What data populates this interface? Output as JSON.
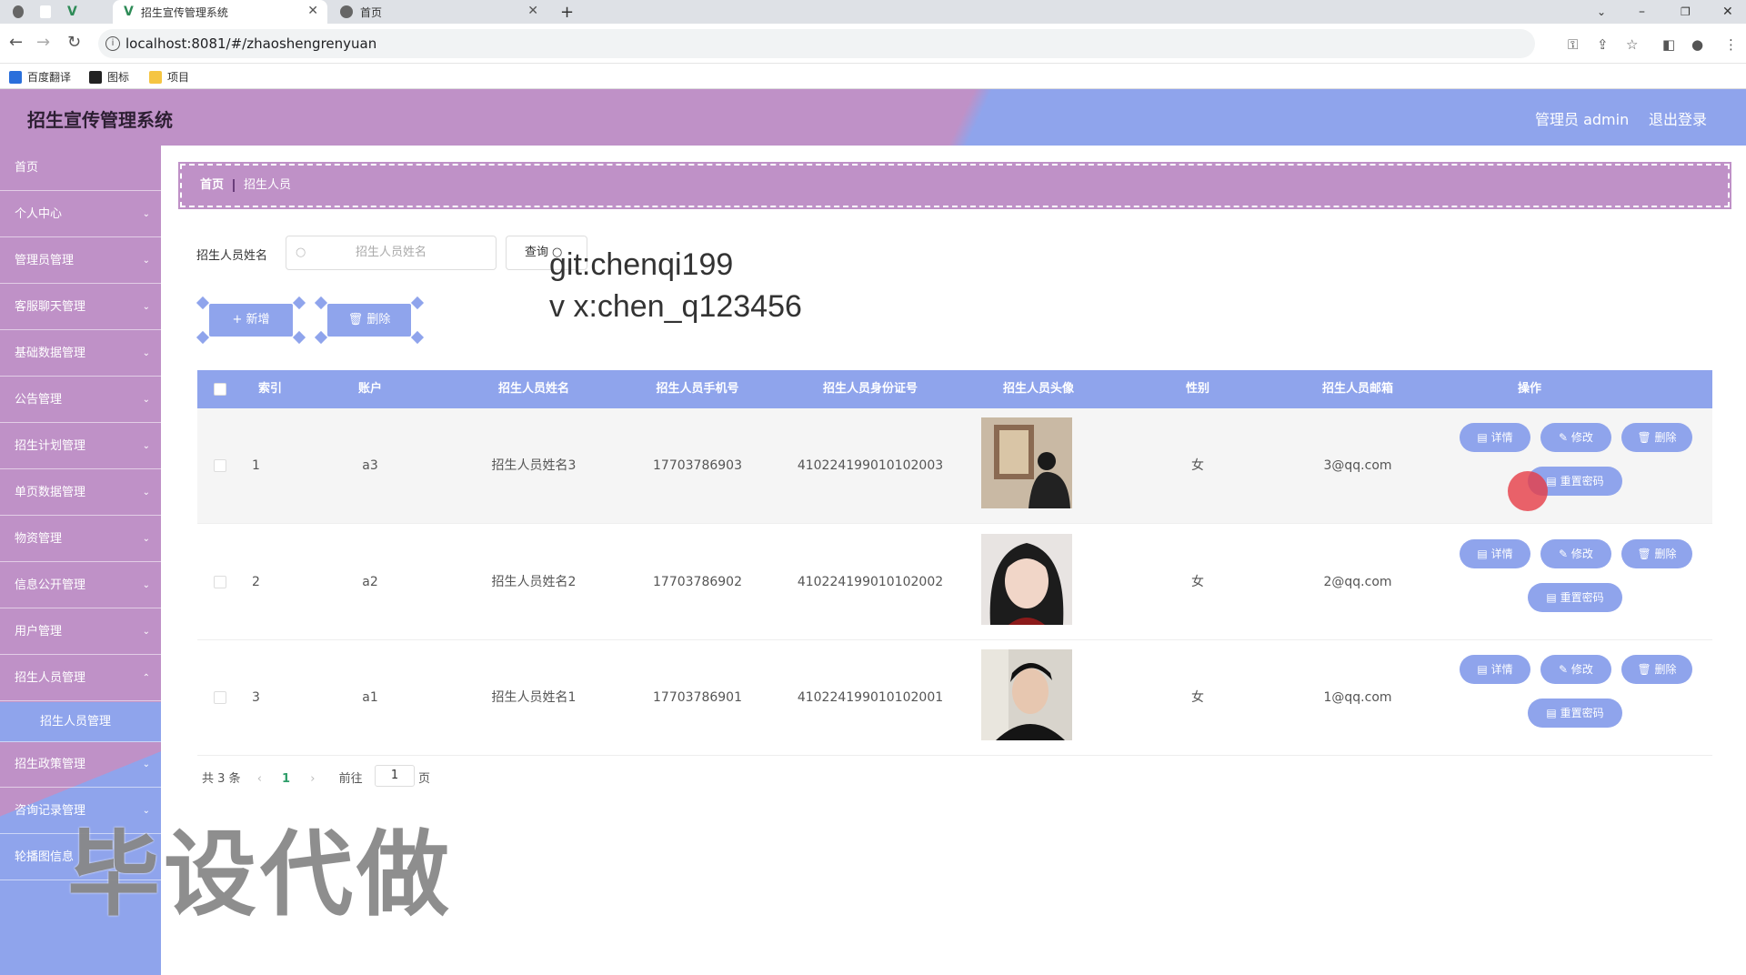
{
  "browser": {
    "tabs": [
      {
        "label": ""
      },
      {
        "label": ""
      },
      {
        "label": "招生宣传管理系统"
      },
      {
        "label": "首页"
      }
    ],
    "url": "localhost:8081/#/zhaoshengrenyuan",
    "bookmarks": [
      "百度翻译",
      "图标",
      "项目"
    ]
  },
  "header": {
    "title": "招生宣传管理系统",
    "admin": "管理员 admin",
    "logout": "退出登录"
  },
  "sidebar": {
    "items": [
      {
        "label": "首页"
      },
      {
        "label": "个人中心"
      },
      {
        "label": "管理员管理"
      },
      {
        "label": "客服聊天管理"
      },
      {
        "label": "基础数据管理"
      },
      {
        "label": "公告管理"
      },
      {
        "label": "招生计划管理"
      },
      {
        "label": "单页数据管理"
      },
      {
        "label": "物资管理"
      },
      {
        "label": "信息公开管理"
      },
      {
        "label": "用户管理"
      },
      {
        "label": "招生人员管理"
      },
      {
        "label": "招生人员管理"
      },
      {
        "label": "招生政策管理"
      },
      {
        "label": "咨询记录管理"
      },
      {
        "label": "轮播图信息"
      }
    ]
  },
  "breadcrumb": {
    "home": "首页",
    "current": "招生人员"
  },
  "search": {
    "label": "招生人员姓名",
    "placeholder": "招生人员姓名",
    "query_label": "查询"
  },
  "actions": {
    "add_label": "新增",
    "delete_label": "删除"
  },
  "watermark": {
    "git": "git:chenqi199",
    "vx": "v x:chen_q123456",
    "big": "毕设代做"
  },
  "table": {
    "headers": [
      "索引",
      "账户",
      "招生人员姓名",
      "招生人员手机号",
      "招生人员身份证号",
      "招生人员头像",
      "性别",
      "招生人员邮箱",
      "操作"
    ],
    "rows": [
      {
        "index": "1",
        "account": "a3",
        "name": "招生人员姓名3",
        "phone": "17703786903",
        "idcard": "410224199010102003",
        "gender": "女",
        "email": "3@qq.com"
      },
      {
        "index": "2",
        "account": "a2",
        "name": "招生人员姓名2",
        "phone": "17703786902",
        "idcard": "410224199010102002",
        "gender": "女",
        "email": "2@qq.com"
      },
      {
        "index": "3",
        "account": "a1",
        "name": "招生人员姓名1",
        "phone": "17703786901",
        "idcard": "410224199010102001",
        "gender": "女",
        "email": "1@qq.com"
      }
    ],
    "ops": {
      "detail": "详情",
      "edit": "修改",
      "delete": "删除",
      "reset": "重置密码"
    }
  },
  "pagination": {
    "total": "共 3 条",
    "current": "1",
    "goto": "前往",
    "page_value": "1",
    "page_suffix": "页"
  },
  "colors": {
    "purple": "#bf91c7",
    "blue": "#8fa4ec"
  }
}
